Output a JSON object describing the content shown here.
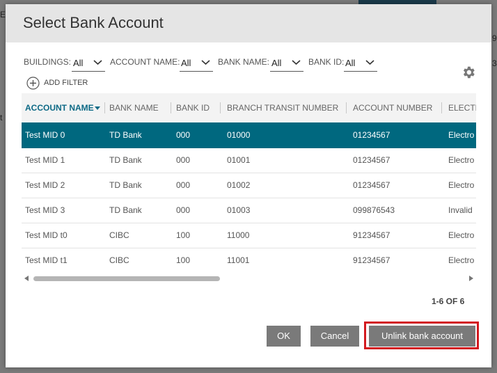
{
  "background_fragments": {
    "frag1": "E",
    "frag2": "9",
    "frag3": "3,",
    "frag4": "t"
  },
  "dialog": {
    "title": "Select Bank Account"
  },
  "filters": [
    {
      "label": "BUILDINGS:",
      "value": "All"
    },
    {
      "label": "ACCOUNT NAME:",
      "value": "All"
    },
    {
      "label": "BANK NAME:",
      "value": "All"
    },
    {
      "label": "BANK ID:",
      "value": "All"
    }
  ],
  "add_filter_label": "ADD FILTER",
  "table": {
    "columns": [
      "ACCOUNT NAME",
      "BANK NAME",
      "BANK ID",
      "BRANCH TRANSIT NUMBER",
      "ACCOUNT NUMBER",
      "ELECTR"
    ],
    "sorted_column": "ACCOUNT NAME",
    "selected_row": 0,
    "rows": [
      [
        "Test MID 0",
        "TD Bank",
        "000",
        "01000",
        "01234567",
        "Electro"
      ],
      [
        "Test MID 1",
        "TD Bank",
        "000",
        "01001",
        "01234567",
        "Electro"
      ],
      [
        "Test MID 2",
        "TD Bank",
        "000",
        "01002",
        "01234567",
        "Electro"
      ],
      [
        "Test MID 3",
        "TD Bank",
        "000",
        "01003",
        "099876543",
        "Invalid"
      ],
      [
        "Test MID t0",
        "CIBC",
        "100",
        "11000",
        "91234567",
        "Electro"
      ],
      [
        "Test MID t1",
        "CIBC",
        "100",
        "11001",
        "91234567",
        "Electro"
      ]
    ]
  },
  "pager": "1-6 OF 6",
  "buttons": {
    "ok": "OK",
    "cancel": "Cancel",
    "unlink": "Unlink bank account"
  },
  "colors": {
    "selected_row": "#00687f",
    "sorted_header": "#0e6a86",
    "button": "#7a7a7a",
    "highlight": "#d3191f"
  },
  "icons": {
    "gear": "gear-icon",
    "add_filter": "plus-circle-icon",
    "dropdown": "chevron-down-icon"
  }
}
